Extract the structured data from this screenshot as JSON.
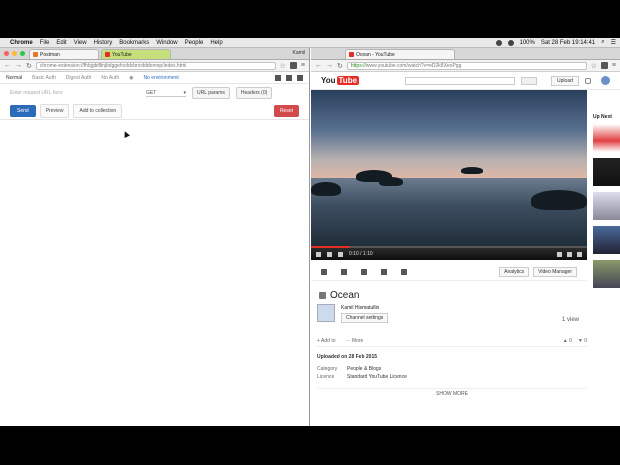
{
  "menubar": {
    "app": "Chrome",
    "items": [
      "File",
      "Edit",
      "View",
      "History",
      "Bookmarks",
      "Window",
      "People",
      "Help"
    ],
    "battery": "100%",
    "datetime": "Sat 28 Feb 19:14:41"
  },
  "left": {
    "tabs": [
      {
        "title": "Postman"
      },
      {
        "title": "YouTube"
      }
    ],
    "user": "Kamil",
    "url": "chrome-extension://fhbjgbiflinjbdggehcddcbncdddomop/index.html",
    "postman": {
      "top": {
        "tab1": "Normal",
        "tab2": "Basic Auth",
        "tab3": "Digest Auth",
        "tab4": "No Auth",
        "env": "No environment"
      },
      "url_placeholder": "Enter request URL here",
      "method": "GET",
      "url_params": "URL params",
      "headers": "Headers (0)",
      "send": "Send",
      "preview": "Preview",
      "add_collection": "Add to collection",
      "reset": "Reset"
    }
  },
  "right": {
    "tab": {
      "title": "Ocean - YouTube"
    },
    "url_secure": "https://",
    "url": "www.youtube.com/watch?v=eD2k8XeoPgg",
    "logo_you": "You",
    "logo_tube": "Tube",
    "upload": "Upload",
    "player": {
      "time": "0:10 / 1:10",
      "progress": 0.14
    },
    "tools": {
      "analytics": "Analytics",
      "video_manager": "Video Manager"
    },
    "video_title": "Ocean",
    "channel": "Kamil Hismatullin",
    "channel_settings": "Channel settings",
    "views": "1 view",
    "add_to": "Add to",
    "more": "More",
    "likes": "0",
    "dislikes": "0",
    "published": "Uploaded on 28 Feb 2015",
    "category_k": "Category",
    "category_v": "People & Blogs",
    "licence_k": "Licence",
    "licence_v": "Standard YouTube Licence",
    "show_more": "SHOW MORE",
    "up_next": "Up Next"
  },
  "colors": {
    "youtube_red": "#e52d27",
    "send_blue": "#2b6bb7",
    "reset_red": "#d34a4a"
  }
}
